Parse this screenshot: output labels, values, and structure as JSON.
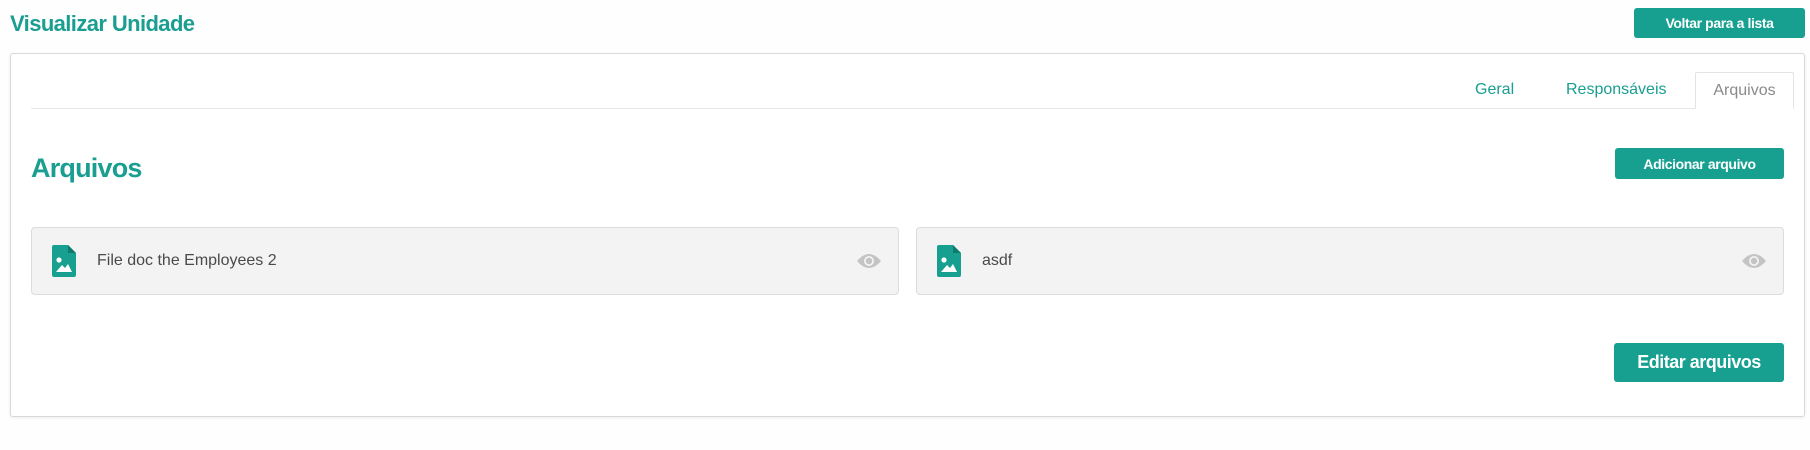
{
  "header": {
    "title": "Visualizar Unidade",
    "back_label": "Voltar para a lista"
  },
  "tabs": [
    {
      "label": "Geral",
      "active": false
    },
    {
      "label": "Responsáveis",
      "active": false
    },
    {
      "label": "Arquivos",
      "active": true
    }
  ],
  "section": {
    "title": "Arquivos",
    "add_label": "Adicionar arquivo"
  },
  "files": [
    {
      "name": "File doc the Employees 2",
      "icon": "file-image-icon",
      "action_icon": "eye-icon"
    },
    {
      "name": "asdf",
      "icon": "file-image-icon",
      "action_icon": "eye-icon"
    }
  ],
  "footer": {
    "edit_label": "Editar arquivos"
  },
  "colors": {
    "accent": "#17a090",
    "title": "#1a9e91",
    "card_bg": "#f3f3f3",
    "icon_muted": "#c4c4c4"
  }
}
